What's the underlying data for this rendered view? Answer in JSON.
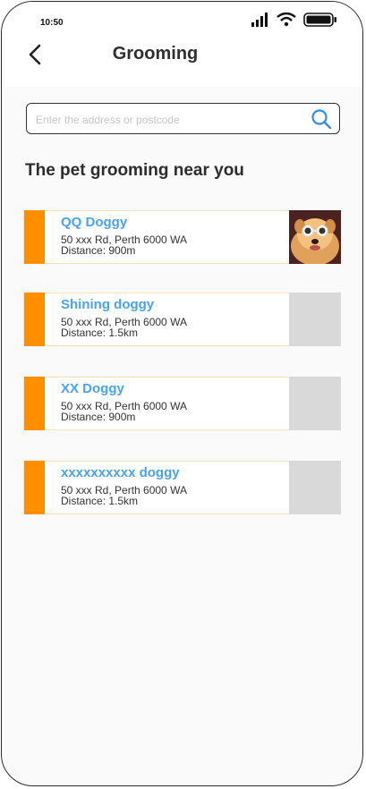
{
  "status_bar": {
    "time": "10:50"
  },
  "header": {
    "title": "Grooming"
  },
  "search": {
    "placeholder": "Enter the address or postcode"
  },
  "section": {
    "heading": "The pet grooming near you"
  },
  "shops": [
    {
      "name": "QQ Doggy",
      "address": "50 xxx Rd, Perth 6000 WA",
      "distance": "Distance: 900m",
      "has_photo": true
    },
    {
      "name": "Shining doggy",
      "address": "50 xxx Rd, Perth 6000 WA",
      "distance": "Distance: 1.5km",
      "has_photo": false
    },
    {
      "name": "XX Doggy",
      "address": "50 xxx Rd, Perth 6000 WA",
      "distance": "Distance: 900m",
      "has_photo": false
    },
    {
      "name": "xxxxxxxxxx doggy",
      "address": "50 xxx Rd, Perth 6000 WA",
      "distance": "Distance: 1.5km",
      "has_photo": false
    }
  ],
  "colors": {
    "accent": "#ff8f00",
    "link": "#4aa3ef",
    "placeholder_thumb": "#d9d9d9"
  }
}
